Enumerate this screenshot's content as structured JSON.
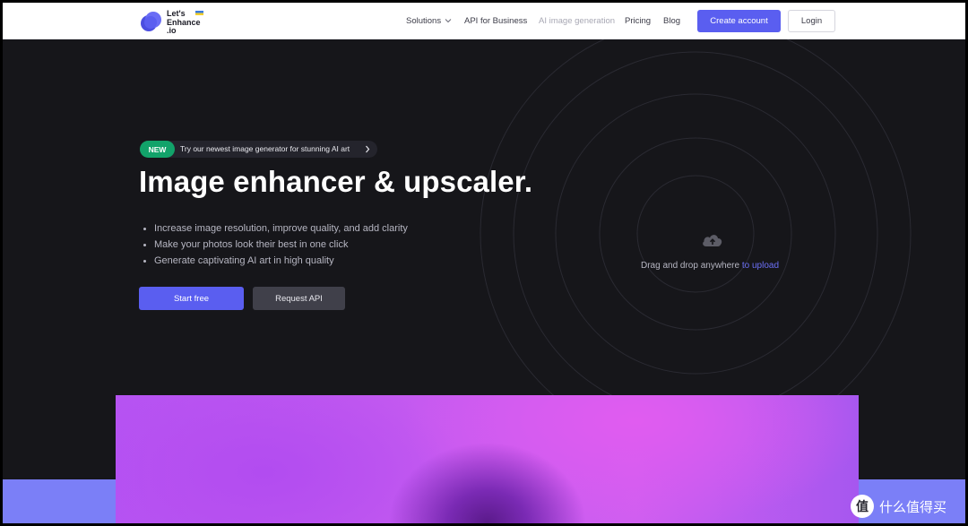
{
  "brand": {
    "logo_lines": [
      "Let's",
      "Enhance",
      ".io"
    ],
    "accent_color": "#5a5ef0",
    "logo_icon": "blob-logo-icon"
  },
  "nav": {
    "links": [
      {
        "label": "Solutions",
        "has_dropdown": true
      },
      {
        "label": "API for Business"
      },
      {
        "label": "AI image generation",
        "muted": true
      },
      {
        "label": "Pricing"
      },
      {
        "label": "Blog"
      }
    ],
    "create_account": "Create account",
    "login": "Login"
  },
  "hero": {
    "badge_label": "NEW",
    "badge_text": "Try our newest image generator for stunning AI art",
    "title": "Image enhancer & upscaler.",
    "bullets": [
      "Increase image resolution, improve quality, and add clarity",
      "Make your photos look their best in one click",
      "Generate captivating AI art in high quality"
    ],
    "start_button": "Start free",
    "api_button": "Request API"
  },
  "upload": {
    "icon": "cloud-upload-icon",
    "text": "Drag and drop anywhere ",
    "link": "to upload"
  },
  "watermark": {
    "text": "什么值得买"
  }
}
